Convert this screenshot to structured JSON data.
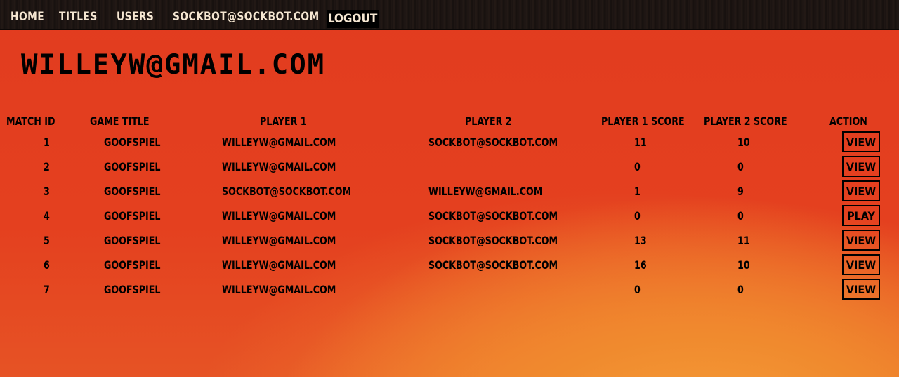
{
  "nav": {
    "home": "HOME",
    "titles": "TITLES",
    "users": "USERS",
    "account": "SOCKBOT@SOCKBOT.COM",
    "logout": "LOGOUT"
  },
  "page": {
    "title": "WILLEYW@GMAIL.COM"
  },
  "table": {
    "headers": {
      "match_id": "MATCH ID",
      "game_title": "GAME TITLE",
      "player1": "PLAYER 1",
      "player2": "PLAYER 2",
      "player1_score": "PLAYER 1 SCORE",
      "player2_score": "PLAYER 2 SCORE",
      "action": "ACTION"
    },
    "rows": [
      {
        "id": "1",
        "game": "GOOFSPIEL",
        "p1": "WILLEYW@GMAIL.COM",
        "p2": "SOCKBOT@SOCKBOT.COM",
        "s1": "11",
        "s2": "10",
        "action": "VIEW"
      },
      {
        "id": "2",
        "game": "GOOFSPIEL",
        "p1": "WILLEYW@GMAIL.COM",
        "p2": "",
        "s1": "0",
        "s2": "0",
        "action": "VIEW"
      },
      {
        "id": "3",
        "game": "GOOFSPIEL",
        "p1": "SOCKBOT@SOCKBOT.COM",
        "p2": "WILLEYW@GMAIL.COM",
        "s1": "1",
        "s2": "9",
        "action": "VIEW"
      },
      {
        "id": "4",
        "game": "GOOFSPIEL",
        "p1": "WILLEYW@GMAIL.COM",
        "p2": "SOCKBOT@SOCKBOT.COM",
        "s1": "0",
        "s2": "0",
        "action": "PLAY"
      },
      {
        "id": "5",
        "game": "GOOFSPIEL",
        "p1": "WILLEYW@GMAIL.COM",
        "p2": "SOCKBOT@SOCKBOT.COM",
        "s1": "13",
        "s2": "11",
        "action": "VIEW"
      },
      {
        "id": "6",
        "game": "GOOFSPIEL",
        "p1": "WILLEYW@GMAIL.COM",
        "p2": "SOCKBOT@SOCKBOT.COM",
        "s1": "16",
        "s2": "10",
        "action": "VIEW"
      },
      {
        "id": "7",
        "game": "GOOFSPIEL",
        "p1": "WILLEYW@GMAIL.COM",
        "p2": "",
        "s1": "0",
        "s2": "0",
        "action": "VIEW"
      }
    ]
  }
}
